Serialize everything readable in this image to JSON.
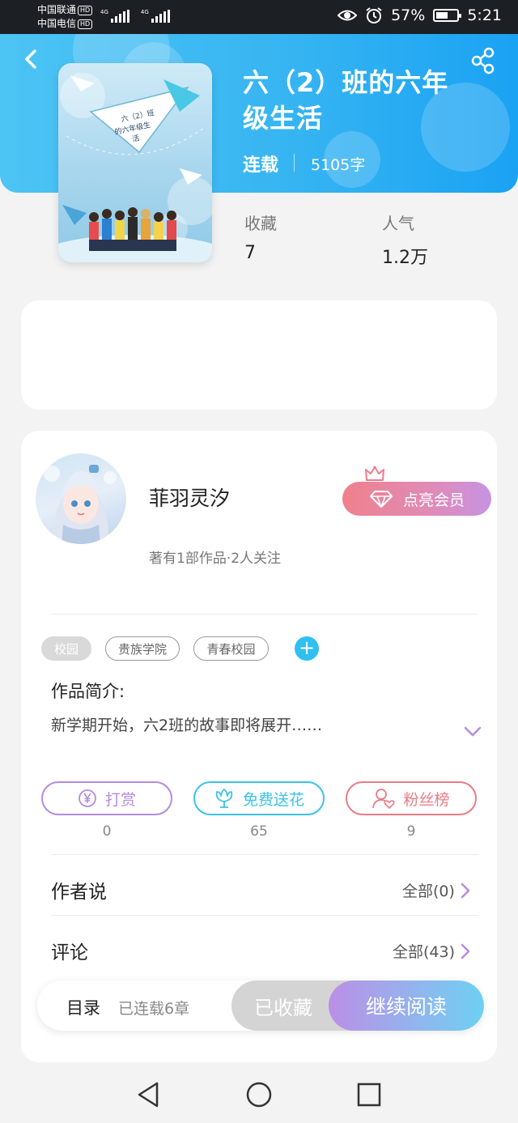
{
  "status_bar": {
    "carrier1": "中国联通",
    "carrier2": "中国电信",
    "hd_badge": "HD",
    "network1": "4G",
    "network2": "4G",
    "battery_percent": "57%",
    "battery_level": 0.57,
    "time": "5:21",
    "icons": [
      "eye-icon",
      "alarm-icon",
      "battery-icon"
    ]
  },
  "header": {
    "back_icon": "chevron-left-icon",
    "share_icon": "share-icon"
  },
  "book": {
    "title": "六（2）班的六年级生活",
    "status": "连载",
    "word_count": "5105字",
    "cover_text": "六（2）班的六年级生活",
    "stats": [
      {
        "label": "收藏",
        "value": "7"
      },
      {
        "label": "人气",
        "value": "1.2万"
      }
    ]
  },
  "author": {
    "name": "菲羽灵汐",
    "meta": "著有1部作品·2人关注",
    "vip_button": "点亮会员"
  },
  "tags": [
    "校园",
    "贵族学院",
    "青春校园"
  ],
  "tag_add": "+",
  "intro": {
    "title": "作品简介:",
    "text": "新学期开始，六2班的故事即将展开……"
  },
  "actions": [
    {
      "label": "打赏",
      "count": "0",
      "icon": "yen-icon",
      "color": "#b68be0"
    },
    {
      "label": "免费送花",
      "count": "65",
      "icon": "flower-icon",
      "color": "#3ac3e8"
    },
    {
      "label": "粉丝榜",
      "count": "9",
      "icon": "fan-user-icon",
      "color": "#ec7b86"
    }
  ],
  "author_says": {
    "title": "作者说",
    "link": "全部(0)"
  },
  "comments": {
    "title": "评论",
    "link": "全部(43)"
  },
  "bottom_bar": {
    "toc": "目录",
    "chapters": "已连载6章",
    "favorited": "已收藏",
    "continue": "继续阅读"
  },
  "nav": [
    "back-triangle-icon",
    "home-circle-icon",
    "recents-square-icon"
  ]
}
